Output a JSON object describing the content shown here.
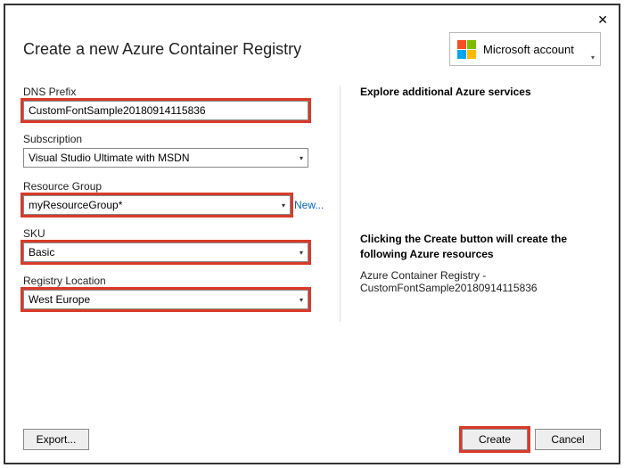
{
  "window": {
    "title": "Create a new Azure Container Registry"
  },
  "account": {
    "label": "Microsoft account"
  },
  "form": {
    "dns": {
      "label": "DNS Prefix",
      "value": "CustomFontSample20180914115836"
    },
    "subscription": {
      "label": "Subscription",
      "value": "Visual Studio Ultimate with MSDN"
    },
    "resource_group": {
      "label": "Resource Group",
      "value": "myResourceGroup*",
      "new_link": "New..."
    },
    "sku": {
      "label": "SKU",
      "value": "Basic"
    },
    "location": {
      "label": "Registry Location",
      "value": "West Europe"
    }
  },
  "right": {
    "heading": "Explore additional Azure services",
    "subheading": "Clicking the Create button will create the following Azure resources",
    "resource_line": "Azure Container Registry - CustomFontSample20180914115836"
  },
  "buttons": {
    "export": "Export...",
    "create": "Create",
    "cancel": "Cancel"
  }
}
